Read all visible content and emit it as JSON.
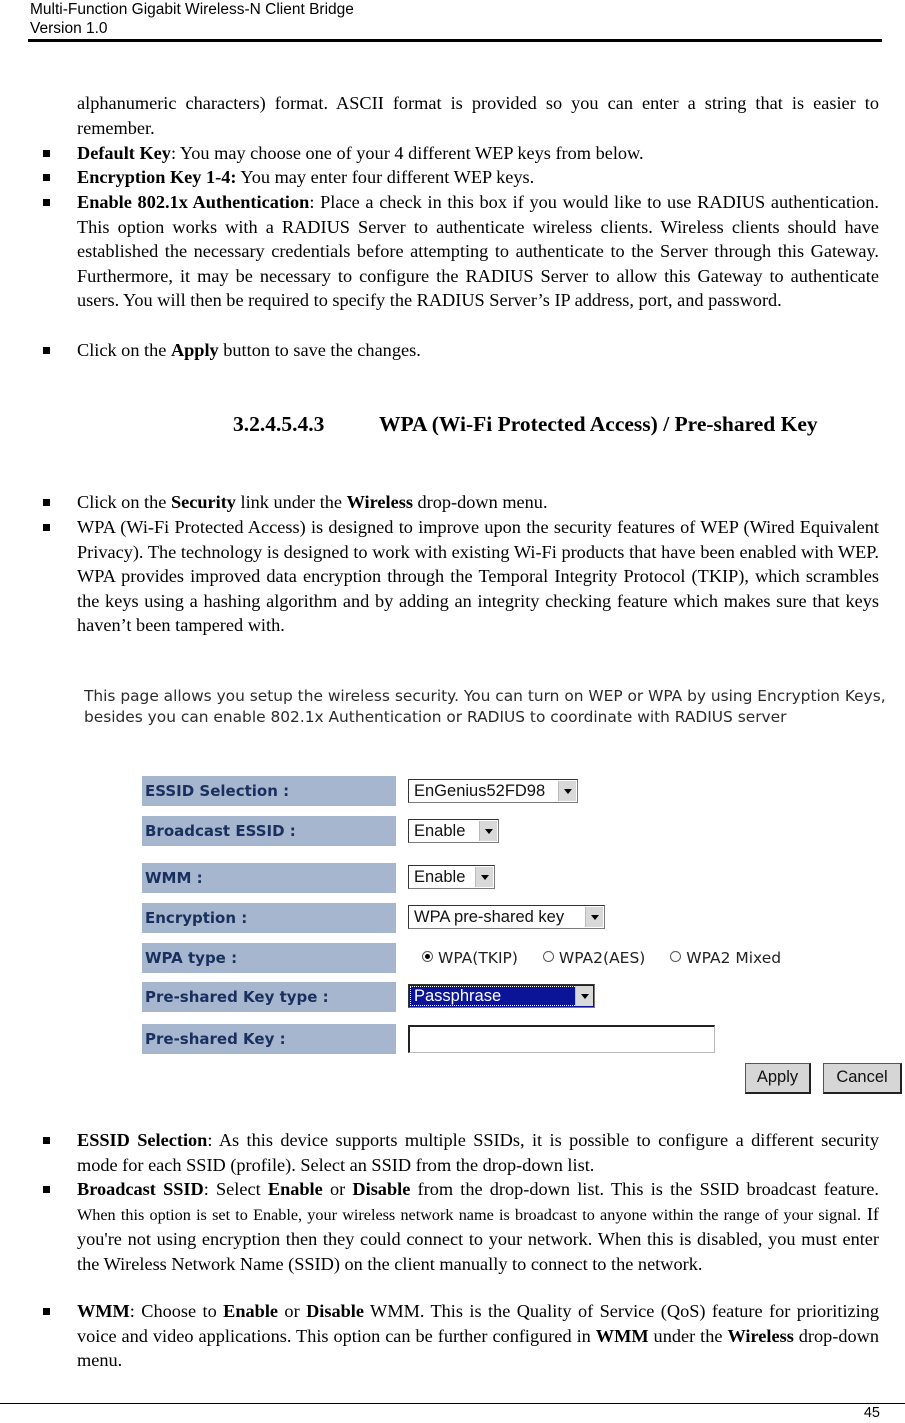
{
  "header": {
    "title": "Multi-Function Gigabit Wireless-N Client Bridge",
    "version": "Version 1.0"
  },
  "intro": {
    "continuation": "alphanumeric characters) format. ASCII format is provided so you can enter a string that is easier to remember."
  },
  "wep_bullets": [
    {
      "bold": "Default Key",
      "text": ": You may choose one of your 4 different WEP keys from below."
    },
    {
      "bold": "Encryption Key 1-4:",
      "text": " You may enter four different WEP keys."
    },
    {
      "bold": "Enable 802.1x Authentication",
      "text": ": Place a check in this box if you would like to use RADIUS authentication. This option works with a RADIUS Server to authenticate wireless clients. Wireless clients should have established the necessary credentials before attempting to authenticate to the Server through this Gateway. Furthermore, it may be necessary to configure the RADIUS Server to allow this Gateway to authenticate users. You will then be required to specify the RADIUS Server’s IP address, port, and password."
    },
    {
      "pre": "Click on the ",
      "bold": "Apply",
      "text": " button to save the changes."
    }
  ],
  "section": {
    "number": "3.2.4.5.4.3",
    "title": "WPA (Wi-Fi Protected Access) / Pre-shared Key"
  },
  "wpa_bullets": [
    {
      "pre": "Click on the ",
      "bold": "Security",
      "mid": " link under the ",
      "bold2": "Wireless",
      "text": " drop-down menu."
    },
    {
      "text": "WPA (Wi-Fi Protected Access) is designed to improve upon the security features of WEP (Wired Equivalent Privacy). The technology is designed to work with existing Wi-Fi products that have been enabled with WEP. WPA provides improved data encryption through the Temporal Integrity Protocol (TKIP), which scrambles the keys using a hashing algorithm and by adding an integrity checking feature which makes sure that keys haven’t been tampered with."
    }
  ],
  "screenshot": {
    "description": "This page allows you setup the wireless security. You can turn on WEP or WPA by using Encryption Keys, besides you can enable 802.1x Authentication or RADIUS to coordinate with RADIUS server",
    "fields": {
      "essid_selection": {
        "label": "ESSID Selection :",
        "value": "EnGenius52FD98"
      },
      "broadcast_essid": {
        "label": "Broadcast ESSID :",
        "value": "Enable"
      },
      "wmm": {
        "label": "WMM :",
        "value": "Enable"
      },
      "encryption": {
        "label": "Encryption :",
        "value": "WPA pre-shared key"
      },
      "wpa_type": {
        "label": "WPA type :",
        "options": [
          "WPA(TKIP)",
          "WPA2(AES)",
          "WPA2 Mixed"
        ],
        "selected": "WPA(TKIP)"
      },
      "psk_type": {
        "label": "Pre-shared Key type :",
        "value": "Passphrase"
      },
      "psk": {
        "label": "Pre-shared Key :",
        "value": ""
      }
    },
    "buttons": {
      "apply": "Apply",
      "cancel": "Cancel"
    },
    "colors": {
      "label_bg": "#a7b6cf",
      "label_text": "#19305e",
      "highlight": "#0b1496"
    }
  },
  "field_bullets": {
    "essid": {
      "bold": "ESSID Selection",
      "text": ": As this device supports multiple SSIDs, it is possible to configure a different security mode for each SSID (profile). Select an SSID from the drop-down list."
    },
    "broadcast": {
      "bold": "Broadcast SSID",
      "t1": ": Select ",
      "b1": "Enable",
      "t2": " or ",
      "b2": "Disable",
      "t3": " from the drop-down list. This is the SSID broadcast feature. ",
      "small": "When this option is set to Enable, your wireless network name is broadcast to anyone within the range of your signal.",
      "t4": " If you're not using encryption then they could connect to your network. When this is disabled, you must enter the Wireless Network Name (SSID) on the client manually to connect to the network."
    },
    "wmm": {
      "bold": "WMM",
      "t1": ": Choose to ",
      "b1": "Enable",
      "t2": " or ",
      "b2": "Disable",
      "t3": " WMM. This is the Quality of Service (QoS) feature for prioritizing voice and video applications. This option can be further configured in ",
      "b3": "WMM",
      "t4": " under the ",
      "b4": "Wireless",
      "t5": " drop-down menu."
    }
  },
  "footer": {
    "page_number": "45"
  }
}
